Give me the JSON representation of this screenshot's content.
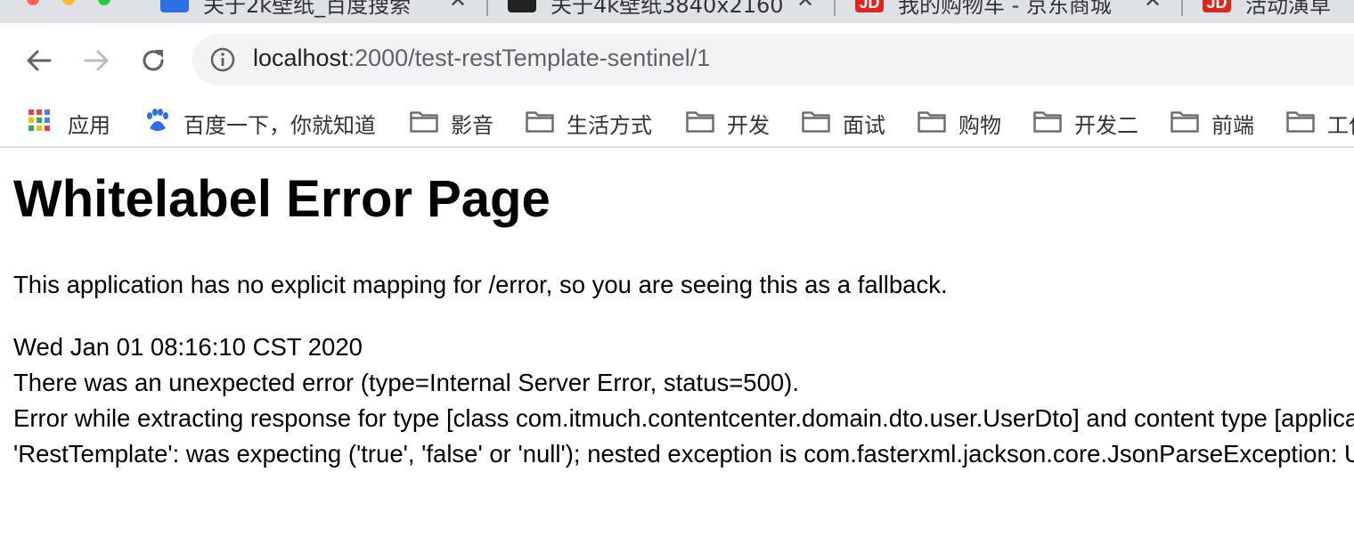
{
  "tabs": [
    {
      "title": "关于2k壁纸_百度搜索",
      "favicon": "baidu-favicon"
    },
    {
      "title": "关于4k壁纸3840x2160",
      "favicon": "dark-favicon"
    },
    {
      "title": "我的购物车 - 京东商城",
      "favicon": "jd-favicon"
    },
    {
      "title": "活动演草",
      "favicon": "jd-favicon"
    }
  ],
  "tab_close_glyph": "✕",
  "jd_favicon_text": "JD",
  "address": {
    "host": "localhost",
    "path": ":2000/test-restTemplate-sentinel/1"
  },
  "bookmarks": [
    {
      "label": "应用",
      "icon": "apps-grid-icon"
    },
    {
      "label": "百度一下，你就知道",
      "icon": "baidu-paw-icon"
    },
    {
      "label": "影音",
      "icon": "folder-icon"
    },
    {
      "label": "生活方式",
      "icon": "folder-icon"
    },
    {
      "label": "开发",
      "icon": "folder-icon"
    },
    {
      "label": "面试",
      "icon": "folder-icon"
    },
    {
      "label": "购物",
      "icon": "folder-icon"
    },
    {
      "label": "开发二",
      "icon": "folder-icon"
    },
    {
      "label": "前端",
      "icon": "folder-icon"
    },
    {
      "label": "工作",
      "icon": "folder-icon"
    }
  ],
  "page": {
    "title": "Whitelabel Error Page",
    "description": "This application has no explicit mapping for /error, so you are seeing this as a fallback.",
    "timestamp": "Wed Jan 01 08:16:10 CST 2020",
    "error_line": "There was an unexpected error (type=Internal Server Error, status=500).",
    "detail_line1": "Error while extracting response for type [class com.itmuch.contentcenter.domain.dto.user.UserDto] and content type [application/json]; nested exception is org.springframework.http.converter.HttpMessageNotReadableException: JSON parse error: Unrecognized token",
    "detail_line2": "'RestTemplate': was expecting ('true', 'false' or 'null'); nested exception is com.fasterxml.jackson.core.JsonParseException: Unrecognized token 'RestTemplate'"
  },
  "colors": {
    "tab_strip": "#dee1e6",
    "omnibox": "#f1f3f4",
    "folder": "#6e6e6e",
    "text": "#000000"
  }
}
